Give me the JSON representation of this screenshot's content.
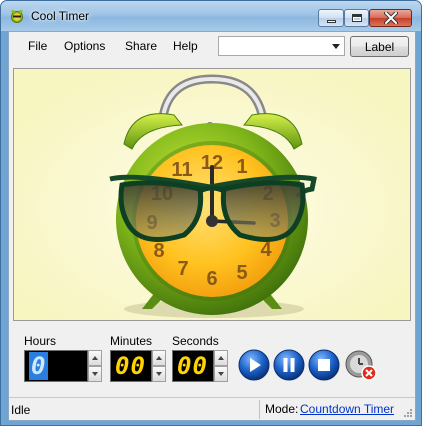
{
  "window": {
    "title": "Cool Timer",
    "icon": "app-clock-icon",
    "controls": [
      "minimize-icon",
      "maximize-icon",
      "close-icon"
    ]
  },
  "menu": {
    "items": [
      "File",
      "Options",
      "Share",
      "Help"
    ],
    "label_combo_value": "",
    "label_button": "Label"
  },
  "picture": {
    "description_icon": "alarm-clock-with-sunglasses-image"
  },
  "timer": {
    "hours_label": "Hours",
    "minutes_label": "Minutes",
    "seconds_label": "Seconds",
    "hours_value": "0",
    "minutes_value": "00",
    "seconds_value": "00"
  },
  "controls": {
    "play_icon": "play-icon",
    "pause_icon": "pause-icon",
    "stop_icon": "stop-icon",
    "alarm_off_icon": "alarm-off-icon"
  },
  "status": {
    "state": "Idle",
    "mode_label": "Mode:",
    "mode_value": "Countdown Timer"
  },
  "colors": {
    "title_bar": "#9fc3e6",
    "digits_on": "#ffd400",
    "hours_digit": "#3aa0ff",
    "picture_bg": "#fcfcd4",
    "control_blue": "#1a5fc8",
    "close_red": "#c5402a"
  }
}
